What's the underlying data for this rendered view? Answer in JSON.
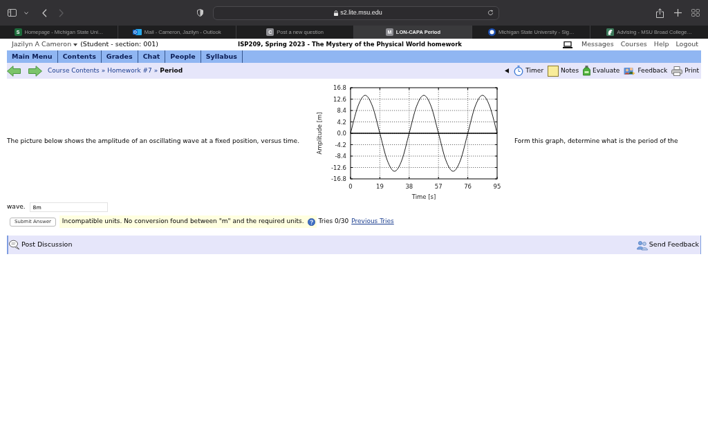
{
  "browser": {
    "address": "s2.lite.msu.edu",
    "tabs": [
      {
        "title": "Homepage - Michigan State Uni…",
        "selected": false,
        "kind": "letter",
        "letter": "S",
        "color": "#1e6b3c"
      },
      {
        "title": "Mail - Cameron, Jazilyn - Outlook",
        "selected": false,
        "kind": "mail"
      },
      {
        "title": "Post a new question",
        "selected": false,
        "kind": "letter",
        "letter": "C",
        "color": "#8e8e93"
      },
      {
        "title": "LON-CAPA Period",
        "selected": true,
        "kind": "letter",
        "letter": "M",
        "color": "#8e8e93"
      },
      {
        "title": "Michigan State University - Sig…",
        "selected": false,
        "kind": "ring"
      },
      {
        "title": "Advising - MSU Broad College…",
        "selected": false,
        "kind": "helmet"
      }
    ]
  },
  "header": {
    "user": "Jazilyn A Cameron",
    "role": "(Student - section: 001)",
    "course_title": "ISP209, Spring 2023 - The Mystery of the Physical World homework",
    "links": [
      "Messages",
      "Courses",
      "Help",
      "Logout"
    ]
  },
  "menu": {
    "items": [
      "Main Menu",
      "Contents",
      "Grades",
      "Chat",
      "People",
      "Syllabus"
    ]
  },
  "breadcrumb": {
    "separator": "»",
    "items": [
      {
        "label": "Course Contents",
        "current": false
      },
      {
        "label": "Homework #7",
        "current": false
      },
      {
        "label": "Period",
        "current": true
      }
    ]
  },
  "tools": [
    {
      "kind": "timer",
      "label": "Timer"
    },
    {
      "kind": "notes",
      "label": "Notes"
    },
    {
      "kind": "evaluate",
      "label": "Evaluate"
    },
    {
      "kind": "feedback",
      "label": "Feedback"
    },
    {
      "kind": "print",
      "label": "Print"
    }
  ],
  "question": {
    "text_before": "The picture below shows the amplitude of an oscillating wave at a fixed position, versus time.",
    "chart_data": [
      {
        "type": "line",
        "xlabel": "Time [s]",
        "ylabel": "Amplitude [m]",
        "xlim": [
          0,
          95
        ],
        "ylim": [
          -16.8,
          16.8
        ],
        "xticks": [
          0,
          19,
          38,
          57,
          76,
          95
        ],
        "yticks": [
          -16.8,
          -12.6,
          -8.4,
          -4.2,
          {
            "value": 0,
            "label": "0.0"
          },
          4.2,
          8.4,
          12.6,
          16.8
        ],
        "grid": true,
        "ref_lines": [
          {
            "axis": "y",
            "value": 0,
            "color": "#000000",
            "line_style": "solid"
          }
        ],
        "x": [
          0,
          4.75,
          9.5,
          14.25,
          19,
          23.75,
          28.5,
          33.25,
          38,
          42.75,
          47.5,
          52.25,
          57,
          61.75,
          66.5,
          71.25,
          76,
          80.75,
          85.5,
          90.25,
          95
        ],
        "values": [
          0,
          9.9,
          14,
          9.9,
          0,
          -9.9,
          -14,
          -9.9,
          0,
          9.9,
          14,
          9.9,
          0,
          -9.9,
          -14,
          -9.9,
          0,
          9.9,
          14,
          9.9,
          0
        ],
        "color": "#000000"
      }
    ],
    "text_after": "Form this graph, determine what is the period of the",
    "text_end": "wave."
  },
  "answer": {
    "value": "8m",
    "submit_label": "Submit Answer",
    "message": "Incompatible units. No conversion found between \"m\" and the required units.",
    "tries": "Tries 0/30",
    "previous_tries": "Previous Tries"
  },
  "discussion": {
    "post_label": "Post Discussion",
    "feedback_label": "Send Feedback"
  }
}
